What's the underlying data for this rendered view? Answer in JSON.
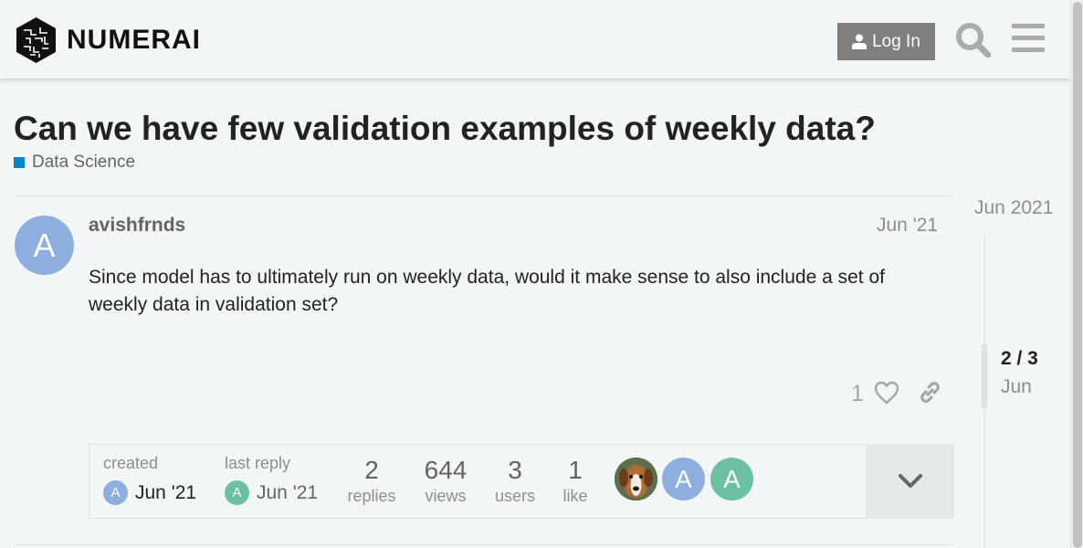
{
  "header": {
    "logo_text": "NUMERAI",
    "login_label": "Log In"
  },
  "topic": {
    "title": "Can we have few validation examples of weekly data?",
    "category": "Data Science",
    "category_color": "#0088cc"
  },
  "post": {
    "avatar_letter": "A",
    "username": "avishfrnds",
    "date": "Jun '21",
    "body": "Since model has to ultimately run on weekly data, would it make sense to also include a set of weekly data in validation set?",
    "like_count": "1"
  },
  "topic_map": {
    "created_label": "created",
    "created_avatar": "A",
    "created_date": "Jun '21",
    "last_reply_label": "last reply",
    "last_reply_avatar": "A",
    "last_reply_date": "Jun '21",
    "stats": [
      {
        "num": "2",
        "label": "replies"
      },
      {
        "num": "644",
        "label": "views"
      },
      {
        "num": "3",
        "label": "users"
      },
      {
        "num": "1",
        "label": "like"
      }
    ],
    "participants": [
      "A",
      "A"
    ]
  },
  "timeline": {
    "start_date": "Jun 2021",
    "position": "2 / 3",
    "current_date": "Jun"
  }
}
